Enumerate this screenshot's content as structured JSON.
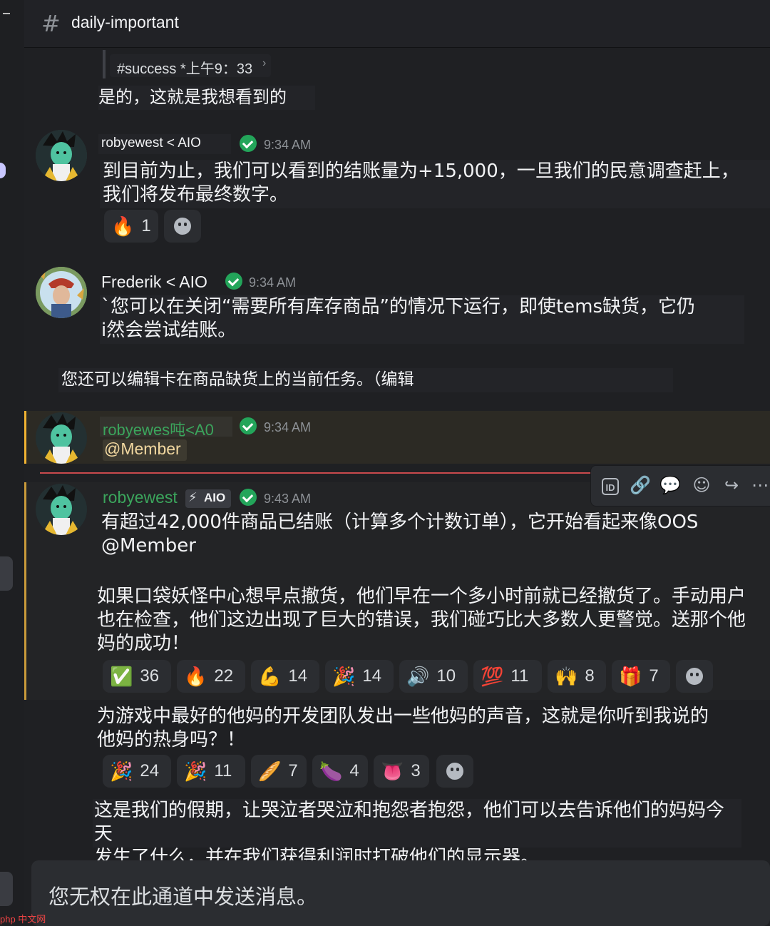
{
  "channel": {
    "name": "daily-important"
  },
  "msg0": {
    "reply_ref": "#success *上午9：33",
    "reply_arrow": "›",
    "text": "是的，这就是我想看到的"
  },
  "msg1": {
    "user": "robyewest < AIO",
    "time": "9:34 AM",
    "line1": "到目前为止，我们可以看到的结账量为+15,000，一旦我们的民意调查赶上，",
    "line2": "我们将发布最终数字。",
    "reactions": [
      {
        "emoji": "🔥",
        "count": "1"
      }
    ]
  },
  "msg2": {
    "user": "Frederik < AIO",
    "time": "9:34 AM",
    "line1": "`您可以在关闭“需要所有库存商品”的情况下运行，即使tems缺货，它仍",
    "line2": "i然会尝试结账。"
  },
  "msg2b": {
    "text": "您还可以编辑卡在商品缺货上的当前任务。（编辑"
  },
  "msg3": {
    "user": "robyewes吨<A0",
    "time": "9:34 AM",
    "mention": "@Member"
  },
  "msg4": {
    "user": "robyewest",
    "tag": "AIO",
    "time": "9:43 AM",
    "line1": "有超过42,000件商品已结账（计算多个计数订单），它开始看起来像OOS",
    "line2": "@Member",
    "p2_line1": "如果口袋妖怪中心想早点撤货，他们早在一个多小时前就已经撤货了。手动用户",
    "p2_line2": "也在检查，他们这边出现了巨大的错误，我们碰巧比大多数人更警觉。送那个他",
    "p2_line3": "妈的成功！",
    "reactions1": [
      {
        "emoji": "✅",
        "count": "36"
      },
      {
        "emoji": "🔥",
        "count": "22"
      },
      {
        "emoji": "💪",
        "count": "14"
      },
      {
        "emoji": "🎉",
        "count": "14"
      },
      {
        "emoji": "🔊",
        "count": "10"
      },
      {
        "emoji": "💯",
        "count": "11"
      },
      {
        "emoji": "🙌",
        "count": "8"
      },
      {
        "emoji": "🎁",
        "count": "7"
      }
    ],
    "p3_line1": "为游戏中最好的他妈的开发团队发出一些他妈的声音，这就是你听到我说的",
    "p3_line2": "他妈的热身吗？！",
    "reactions2": [
      {
        "emoji": "🎉",
        "count": "24"
      },
      {
        "emoji": "🎉",
        "count": "11"
      },
      {
        "emoji": "🥖",
        "count": "7"
      },
      {
        "emoji": "🍆",
        "count": "4"
      },
      {
        "emoji": "👅",
        "count": "3"
      }
    ],
    "p4_line1": "这是我们的假期，让哭泣者哭泣和抱怨者抱怨，他们可以去告诉他们的妈妈今天",
    "p4_line2": "发生了什么，并在我们获得利润时打破他们的显示器。"
  },
  "toolbar": {
    "id_label": "ID",
    "icons": [
      "id-icon",
      "link-icon",
      "thread-icon",
      "emoji-icon",
      "forward-icon",
      "more-icon"
    ]
  },
  "composer": {
    "notice": "您无权在此通道中发送消息。"
  },
  "watermark": "php 中文网",
  "colors": {
    "accent_name": "#3ba55c",
    "verified": "#23a55a",
    "new_divider": "#f23f43",
    "highlight_bar": "#f0b232"
  }
}
